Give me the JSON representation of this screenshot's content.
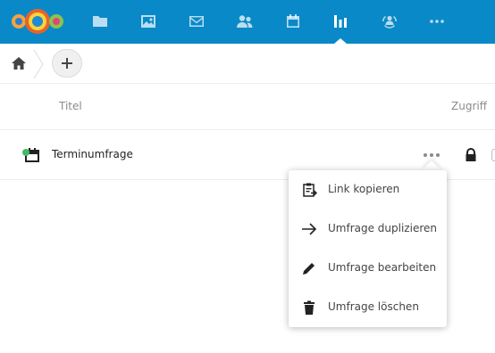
{
  "colors": {
    "brand": "#0a89c8",
    "status_dot": "#46ba61"
  },
  "nav": {
    "items": [
      {
        "name": "files",
        "icon": "folder-icon"
      },
      {
        "name": "gallery",
        "icon": "image-icon"
      },
      {
        "name": "mail",
        "icon": "mail-icon"
      },
      {
        "name": "contacts",
        "icon": "contacts-icon"
      },
      {
        "name": "calendar",
        "icon": "calendar-icon"
      },
      {
        "name": "polls",
        "icon": "bar-chart-icon",
        "active": true
      },
      {
        "name": "circles",
        "icon": "circles-icon"
      },
      {
        "name": "more-apps",
        "icon": "more-icon"
      }
    ]
  },
  "breadcrumb": {
    "home_icon": "home-icon",
    "add_icon": "plus-icon"
  },
  "table": {
    "columns": {
      "title": "Titel",
      "access": "Zugriff"
    },
    "rows": [
      {
        "title": "Terminumfrage",
        "type_icon": "date-poll-icon",
        "access_icon": "lock-icon"
      }
    ]
  },
  "menu": {
    "items": [
      {
        "label": "Link kopieren",
        "icon": "clipboard-icon"
      },
      {
        "label": "Umfrage duplizieren",
        "icon": "arrow-right-icon"
      },
      {
        "label": "Umfrage bearbeiten",
        "icon": "pencil-icon"
      },
      {
        "label": "Umfrage löschen",
        "icon": "trash-icon"
      }
    ]
  }
}
